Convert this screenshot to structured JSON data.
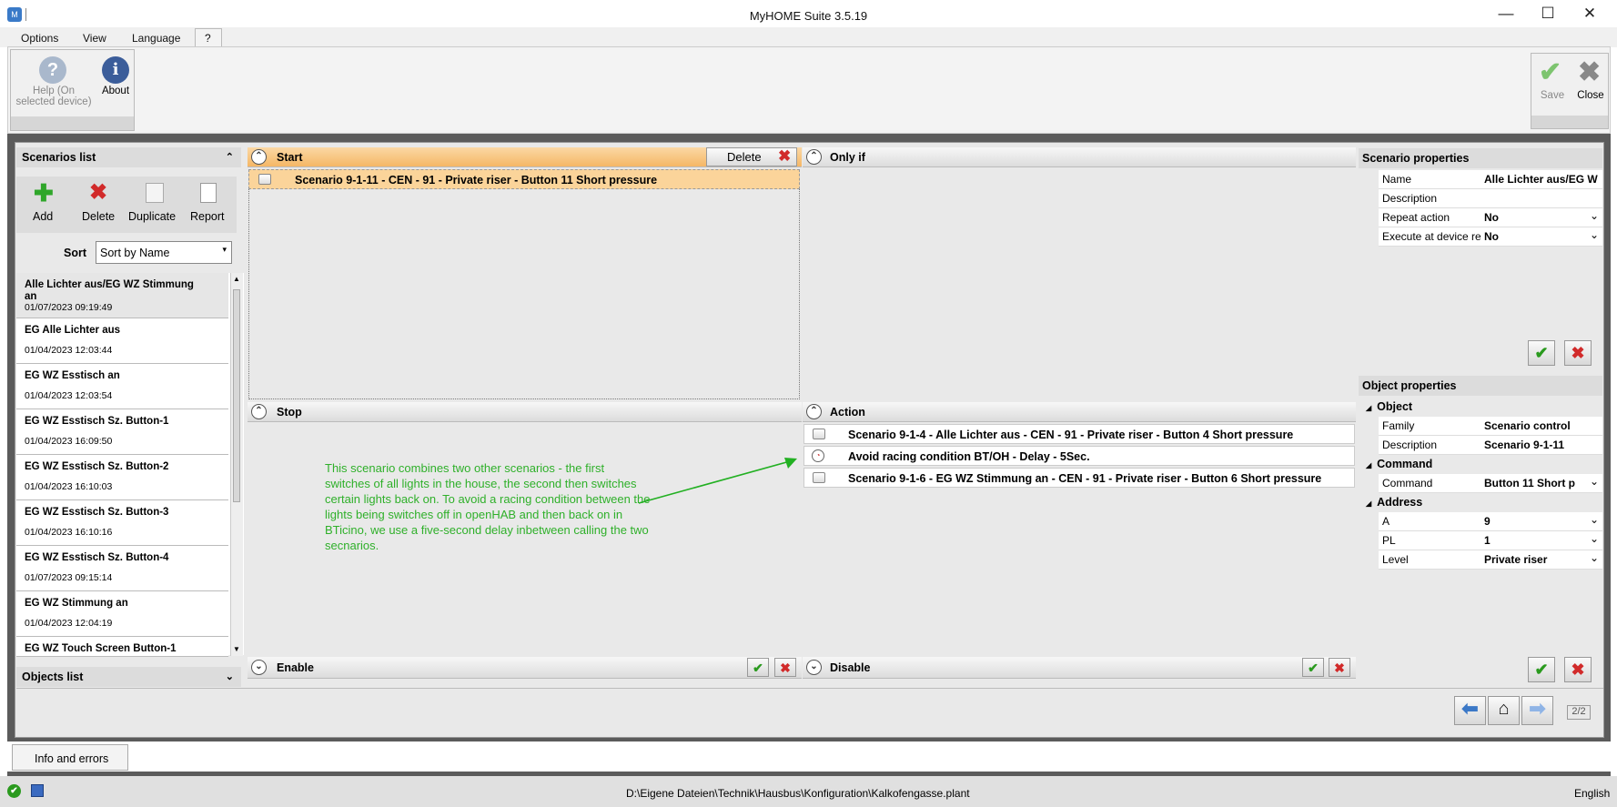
{
  "window": {
    "title": "MyHOME Suite 3.5.19",
    "minimize": "—",
    "maximize": "☐",
    "close": "✕"
  },
  "menu": [
    "Options",
    "View",
    "Language",
    "?"
  ],
  "ribbon": {
    "help_label": "Help (On selected device)",
    "about_label": "About",
    "save_label": "Save",
    "close_label": "Close"
  },
  "scenarios_list": {
    "title": "Scenarios list",
    "toolbar": {
      "add": "Add",
      "delete": "Delete",
      "duplicate": "Duplicate",
      "report": "Report"
    },
    "sort_label": "Sort",
    "sort_value": "Sort by Name",
    "items": [
      {
        "name": "Alle Lichter aus/EG WZ Stimmung an",
        "date": "01/07/2023 09:19:49"
      },
      {
        "name": "EG Alle Lichter aus",
        "date": "01/04/2023 12:03:44"
      },
      {
        "name": "EG WZ Esstisch an",
        "date": "01/04/2023 12:03:54"
      },
      {
        "name": "EG WZ Esstisch Sz. Button-1",
        "date": "01/04/2023 16:09:50"
      },
      {
        "name": "EG WZ Esstisch Sz. Button-2",
        "date": "01/04/2023 16:10:03"
      },
      {
        "name": "EG WZ Esstisch Sz. Button-3",
        "date": "01/04/2023 16:10:16"
      },
      {
        "name": "EG WZ Esstisch Sz. Button-4",
        "date": "01/07/2023 09:15:14"
      },
      {
        "name": "EG WZ Stimmung an",
        "date": "01/04/2023 12:04:19"
      },
      {
        "name": "EG WZ Touch Screen Button-1",
        "date": ""
      }
    ],
    "objects_list": "Objects list"
  },
  "start": {
    "title": "Start",
    "delete_label": "Delete",
    "row": "Scenario 9-1-11 - CEN - 91 - Private riser - Button 11 Short pressure"
  },
  "only_if": {
    "title": "Only if"
  },
  "stop": {
    "title": "Stop"
  },
  "action": {
    "title": "Action",
    "rows": [
      "Scenario 9-1-4 - Alle Lichter aus - CEN - 91 - Private riser - Button 4 Short pressure",
      "Avoid racing condition BT/OH - Delay - 5Sec.",
      "Scenario 9-1-6 - EG WZ Stimmung an - CEN - 91 - Private riser - Button 6 Short pressure"
    ]
  },
  "annotation": "This scenario combines two other scenarios - the first switches of all lights in the house, the second then switches certain lights back on. To avoid a racing condition between the lights being switches off in openHAB and then back on in BTicino, we use a five-second delay inbetween calling the two secnarios.",
  "enable": {
    "title": "Enable"
  },
  "disable": {
    "title": "Disable"
  },
  "scenario_properties": {
    "title": "Scenario properties",
    "rows": [
      {
        "label": "Name",
        "value": "Alle Lichter aus/EG W"
      },
      {
        "label": "Description",
        "value": ""
      },
      {
        "label": "Repeat action",
        "value": "No"
      },
      {
        "label": "Execute at device re",
        "value": "No"
      }
    ]
  },
  "object_properties": {
    "title": "Object properties",
    "sections": {
      "object": "Object",
      "command": "Command",
      "address": "Address"
    },
    "object_rows": [
      {
        "label": "Family",
        "value": "Scenario control"
      },
      {
        "label": "Description",
        "value": "Scenario 9-1-11"
      }
    ],
    "command_rows": [
      {
        "label": "Command",
        "value": "Button 11 Short p"
      }
    ],
    "address_rows": [
      {
        "label": "A",
        "value": "9"
      },
      {
        "label": "PL",
        "value": "1"
      },
      {
        "label": "Level",
        "value": "Private riser"
      }
    ]
  },
  "nav": {
    "page": "2/2"
  },
  "info_tab": "Info and errors",
  "status": {
    "path": "D:\\Eigene Dateien\\Technik\\Hausbus\\Konfiguration\\Kalkofengasse.plant",
    "language": "English"
  },
  "colors": {
    "accent_orange": "#f8c27a",
    "ok_green": "#2a9a1e",
    "cancel_red": "#d12a2a",
    "arrow_green": "#22b022"
  }
}
